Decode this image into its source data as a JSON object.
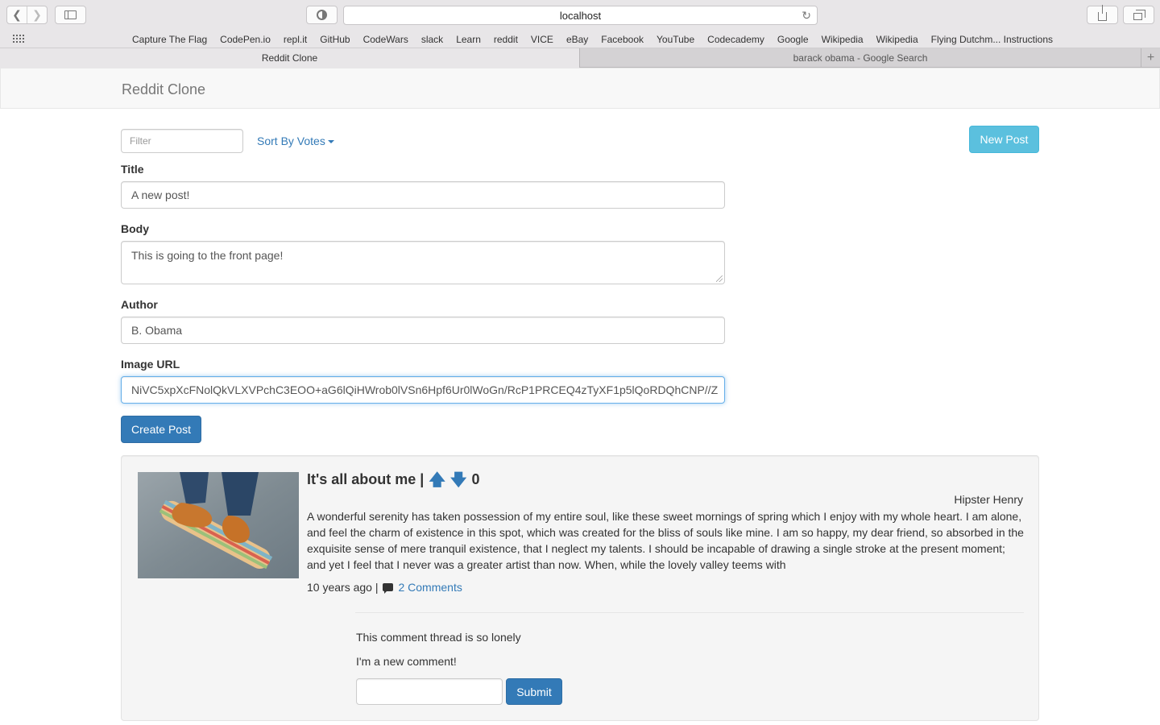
{
  "browser": {
    "address": "localhost",
    "bookmarks": [
      "Capture The Flag",
      "CodePen.io",
      "repl.it",
      "GitHub",
      "CodeWars",
      "slack",
      "Learn",
      "reddit",
      "VICE",
      "eBay",
      "Facebook",
      "YouTube",
      "Codecademy",
      "Google",
      "Wikipedia",
      "Wikipedia",
      "Flying Dutchm... Instructions"
    ],
    "tabs": [
      {
        "label": "Reddit Clone",
        "active": true
      },
      {
        "label": "barack obama - Google Search",
        "active": false
      }
    ]
  },
  "navbar": {
    "brand": "Reddit Clone"
  },
  "controls": {
    "filter_placeholder": "Filter",
    "sort_label": "Sort By Votes",
    "new_post_label": "New Post"
  },
  "form": {
    "title_label": "Title",
    "title_value": "A new post!",
    "body_label": "Body",
    "body_value": "This is going to the front page!",
    "author_label": "Author",
    "author_value": "B. Obama",
    "image_label": "Image URL",
    "image_value": "NiVC5xpXcFNolQkVLXVPchC3EOO+aG6lQiHWrob0lVSn6Hpf6Ur0lWoGn/RcP1PRCEQ4zTyXF1p5lQoRDQhCNP//Z",
    "submit_label": "Create Post"
  },
  "post": {
    "title": "It's all about me |",
    "votes": "0",
    "author": "Hipster Henry",
    "body": "A wonderful serenity has taken possession of my entire soul, like these sweet mornings of spring which I enjoy with my whole heart. I am alone, and feel the charm of existence in this spot, which was created for the bliss of souls like mine. I am so happy, my dear friend, so absorbed in the exquisite sense of mere tranquil existence, that I neglect my talents. I should be incapable of drawing a single stroke at the present moment; and yet I feel that I never was a greater artist than now. When, while the lovely valley teems with",
    "age": "10 years ago |",
    "comments_link": "2 Comments",
    "comments": [
      "This comment thread is so lonely",
      "I'm a new comment!"
    ],
    "comment_submit_label": "Submit"
  },
  "colors": {
    "primary": "#337ab7",
    "info": "#5bc0de",
    "navbar_bg": "#f8f8f8",
    "well_bg": "#f5f5f5"
  }
}
